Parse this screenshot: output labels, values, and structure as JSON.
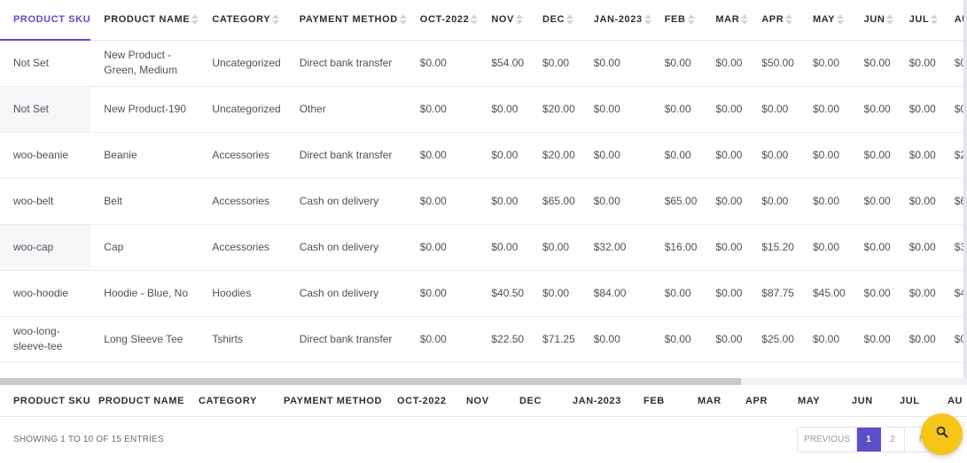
{
  "table": {
    "headers": [
      {
        "label": "PRODUCT SKU",
        "active": true,
        "sort": false
      },
      {
        "label": "PRODUCT NAME",
        "active": false,
        "sort": true
      },
      {
        "label": "CATEGORY",
        "active": false,
        "sort": true
      },
      {
        "label": "PAYMENT METHOD",
        "active": false,
        "sort": true
      },
      {
        "label": "OCT-2022",
        "active": false,
        "sort": true
      },
      {
        "label": "NOV",
        "active": false,
        "sort": true
      },
      {
        "label": "DEC",
        "active": false,
        "sort": true
      },
      {
        "label": "JAN-2023",
        "active": false,
        "sort": true
      },
      {
        "label": "FEB",
        "active": false,
        "sort": true
      },
      {
        "label": "MAR",
        "active": false,
        "sort": true
      },
      {
        "label": "APR",
        "active": false,
        "sort": true
      },
      {
        "label": "MAY",
        "active": false,
        "sort": true
      },
      {
        "label": "JUN",
        "active": false,
        "sort": true
      },
      {
        "label": "JUL",
        "active": false,
        "sort": true
      },
      {
        "label": "AU",
        "active": false,
        "sort": false
      }
    ],
    "rows": [
      [
        "Not Set",
        "New Product - Green, Medium",
        "Uncategorized",
        "Direct bank transfer",
        "$0.00",
        "$54.00",
        "$0.00",
        "$0.00",
        "$0.00",
        "$0.00",
        "$50.00",
        "$0.00",
        "$0.00",
        "$0.00",
        "$0"
      ],
      [
        "Not Set",
        "New Product-190",
        "Uncategorized",
        "Other",
        "$0.00",
        "$0.00",
        "$20.00",
        "$0.00",
        "$0.00",
        "$0.00",
        "$0.00",
        "$0.00",
        "$0.00",
        "$0.00",
        "$0"
      ],
      [
        "woo-beanie",
        "Beanie",
        "Accessories",
        "Direct bank transfer",
        "$0.00",
        "$0.00",
        "$20.00",
        "$0.00",
        "$0.00",
        "$0.00",
        "$0.00",
        "$0.00",
        "$0.00",
        "$0.00",
        "$2"
      ],
      [
        "woo-belt",
        "Belt",
        "Accessories",
        "Cash on delivery",
        "$0.00",
        "$0.00",
        "$65.00",
        "$0.00",
        "$65.00",
        "$0.00",
        "$0.00",
        "$0.00",
        "$0.00",
        "$0.00",
        "$6"
      ],
      [
        "woo-cap",
        "Cap",
        "Accessories",
        "Cash on delivery",
        "$0.00",
        "$0.00",
        "$0.00",
        "$32.00",
        "$16.00",
        "$0.00",
        "$15.20",
        "$0.00",
        "$0.00",
        "$0.00",
        "$3"
      ],
      [
        "woo-hoodie",
        "Hoodie - Blue, No",
        "Hoodies",
        "Cash on delivery",
        "$0.00",
        "$40.50",
        "$0.00",
        "$84.00",
        "$0.00",
        "$0.00",
        "$87.75",
        "$45.00",
        "$0.00",
        "$0.00",
        "$4"
      ],
      [
        "woo-long-sleeve-tee",
        "Long Sleeve Tee",
        "Tshirts",
        "Direct bank transfer",
        "$0.00",
        "$22.50",
        "$71.25",
        "$0.00",
        "$0.00",
        "$0.00",
        "$25.00",
        "$0.00",
        "$0.00",
        "$0.00",
        "$0"
      ]
    ],
    "footer_headers": [
      "PRODUCT SKU",
      "PRODUCT NAME",
      "CATEGORY",
      "PAYMENT METHOD",
      "OCT-2022",
      "NOV",
      "DEC",
      "JAN-2023",
      "FEB",
      "MAR",
      "APR",
      "MAY",
      "JUN",
      "JUL",
      "AU"
    ]
  },
  "info": {
    "entries_text": "SHOWING 1 TO 10 OF 15 ENTRIES"
  },
  "pagination": {
    "previous_label": "PREVIOUS",
    "pages": [
      "1",
      "2"
    ],
    "current_page": "1",
    "next_label": "N"
  },
  "colors": {
    "accent": "#5a4fc8",
    "fab": "#f5c518"
  },
  "icons": {
    "fab": "search-icon"
  }
}
